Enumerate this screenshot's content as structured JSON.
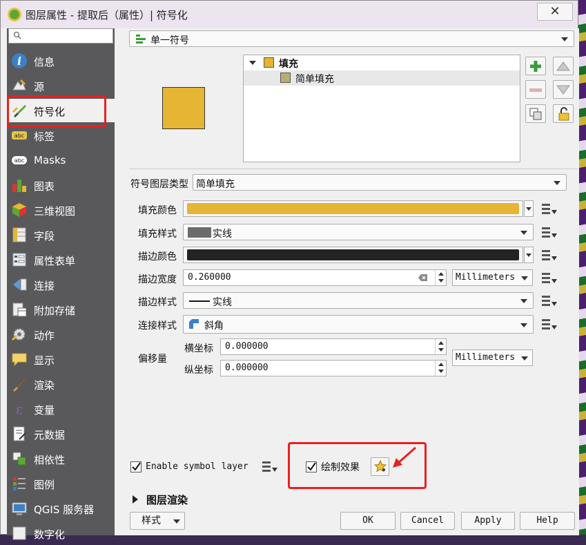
{
  "window": {
    "title": "图层属性 - 提取后（属性）| 符号化"
  },
  "sidebar": {
    "search_placeholder": "",
    "items": [
      {
        "label": "信息",
        "icon": "info-icon"
      },
      {
        "label": "源",
        "icon": "source-icon"
      },
      {
        "label": "符号化",
        "icon": "paintbrush-icon",
        "active": true
      },
      {
        "label": "标签",
        "icon": "abc-label-icon"
      },
      {
        "label": "Masks",
        "icon": "abc-mask-icon"
      },
      {
        "label": "图表",
        "icon": "diagram-icon"
      },
      {
        "label": "三维视图",
        "icon": "cube-3d-icon"
      },
      {
        "label": "字段",
        "icon": "fields-icon"
      },
      {
        "label": "属性表单",
        "icon": "form-icon"
      },
      {
        "label": "连接",
        "icon": "join-icon"
      },
      {
        "label": "附加存储",
        "icon": "storage-icon"
      },
      {
        "label": "动作",
        "icon": "action-gear-icon"
      },
      {
        "label": "显示",
        "icon": "display-bubble-icon"
      },
      {
        "label": "渲染",
        "icon": "render-brush-icon"
      },
      {
        "label": "变量",
        "icon": "variable-epsilon-icon"
      },
      {
        "label": "元数据",
        "icon": "metadata-icon"
      },
      {
        "label": "相依性",
        "icon": "dependency-icon"
      },
      {
        "label": "图例",
        "icon": "legend-icon"
      },
      {
        "label": "QGIS 服务器",
        "icon": "qgis-server-icon"
      },
      {
        "label": "数字化",
        "icon": "digitize-icon"
      }
    ]
  },
  "renderer": {
    "type_label": "单一符号"
  },
  "symbol_tree": {
    "root_label": "填充",
    "child_label": "简单填充"
  },
  "layer_type": {
    "label": "符号图层类型",
    "value": "简单填充"
  },
  "form": {
    "fill_color_label": "填充颜色",
    "fill_style_label": "填充样式",
    "fill_style_value": "实线",
    "stroke_color_label": "描边颜色",
    "stroke_width_label": "描边宽度",
    "stroke_width_value": "0.260000",
    "stroke_width_unit": "Millimeters",
    "stroke_style_label": "描边样式",
    "stroke_style_value": "实线",
    "join_style_label": "连接样式",
    "join_style_value": "斜角",
    "offset_label": "偏移量",
    "offset_x_label": "横坐标",
    "offset_x_value": "0.000000",
    "offset_y_label": "纵坐标",
    "offset_y_value": "0.000000",
    "offset_unit": "Millimeters"
  },
  "colors": {
    "fill": "#e5b533",
    "stroke": "#232323",
    "fill_style_swatch": "#6b6b6b",
    "highlight": "#e82020"
  },
  "enable_symbol_layer": {
    "label": "Enable symbol layer",
    "checked": true
  },
  "draw_effects": {
    "label": "绘制效果",
    "checked": true
  },
  "layer_rendering": {
    "label": "图层渲染"
  },
  "footer": {
    "style_label": "样式",
    "ok_label": "OK",
    "cancel_label": "Cancel",
    "apply_label": "Apply",
    "help_label": "Help"
  }
}
